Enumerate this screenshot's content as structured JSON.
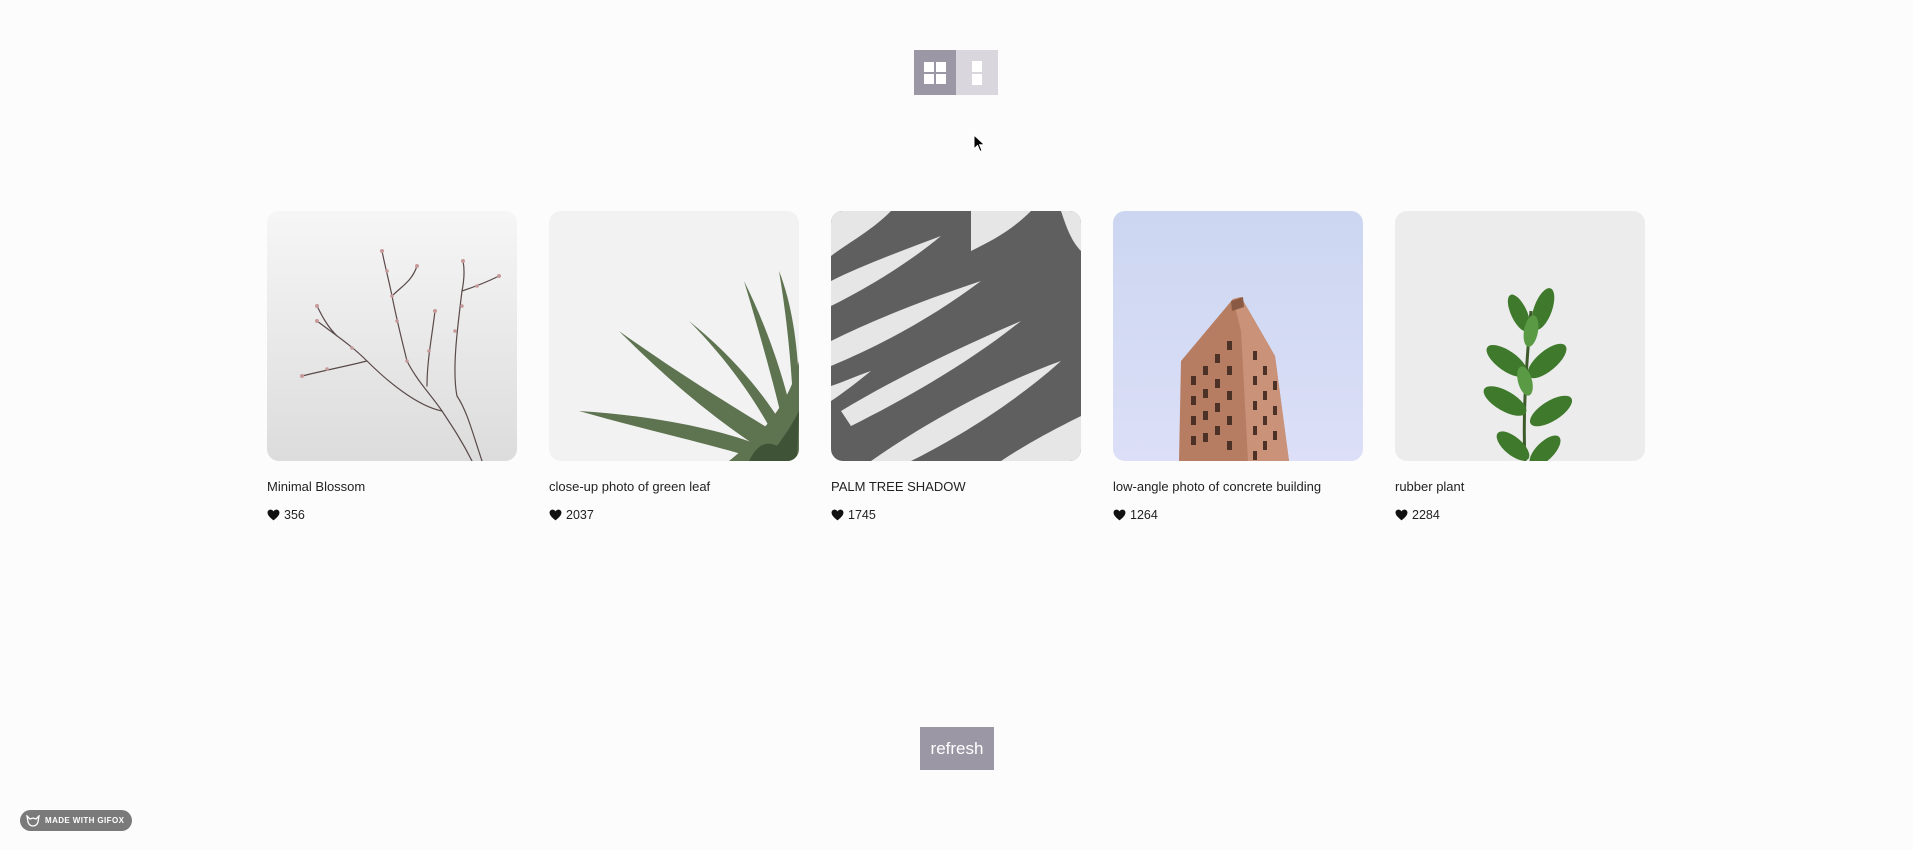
{
  "view_toggle": {
    "active": "grid",
    "grid_icon": "grid-icon",
    "list_icon": "list-icon"
  },
  "gallery": {
    "items": [
      {
        "title": "Minimal Blossom",
        "likes": "356",
        "image": "branch-blossom"
      },
      {
        "title": "close-up photo of green leaf",
        "likes": "2037",
        "image": "green-leaf"
      },
      {
        "title": "PALM TREE SHADOW",
        "likes": "1745",
        "image": "palm-shadow"
      },
      {
        "title": "low-angle photo of concrete building",
        "likes": "1264",
        "image": "flatiron-building"
      },
      {
        "title": "rubber plant",
        "likes": "2284",
        "image": "rubber-plant"
      }
    ],
    "like_icon": "heart-icon"
  },
  "refresh": {
    "label": "refresh"
  },
  "badge": {
    "label": "MADE WITH GIFOX",
    "icon": "fox-icon"
  },
  "colors": {
    "accent": "#9b97a4",
    "accent_light": "#d9d7dd",
    "background": "#fcfcfc",
    "badge": "#7a7a7a"
  }
}
